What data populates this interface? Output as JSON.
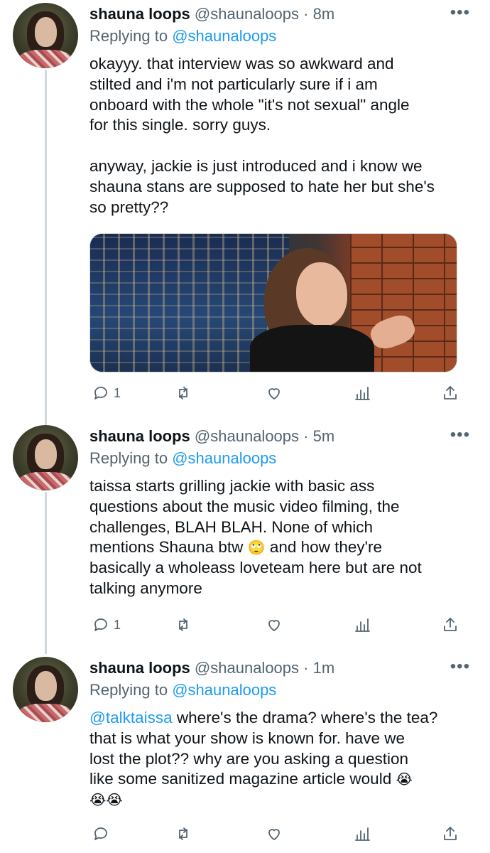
{
  "tweets": [
    {
      "name": "shauna loops",
      "handle": "@shaunaloops",
      "separator": "·",
      "time": "8m",
      "reply_prefix": "Replying to",
      "reply_to": "@shaunaloops",
      "body_lines": [
        "okayyy. that interview was so awkward and",
        "stilted and i'm not particularly sure if i am",
        "onboard with the whole \"it's not sexual\" angle",
        "for this single. sorry guys.",
        "",
        "anyway, jackie is just introduced and i know we",
        "shauna stans are supposed to hate her but she's",
        "so pretty??"
      ],
      "reply_count": "1",
      "retweet_count": "",
      "like_count": ""
    },
    {
      "name": "shauna loops",
      "handle": "@shaunaloops",
      "separator": "·",
      "time": "5m",
      "reply_prefix": "Replying to",
      "reply_to": "@shaunaloops",
      "body_lines": [
        "taissa starts grilling jackie with basic ass",
        "questions about the music video filming, the",
        "challenges, BLAH BLAH. None of which",
        "mentions Shauna btw",
        "basically a wholeass loveteam here but are not",
        "talking anymore"
      ],
      "emoji_eyeroll": "🙄",
      "line4_tail": " and how they're",
      "reply_count": "1",
      "retweet_count": "",
      "like_count": ""
    },
    {
      "name": "shauna loops",
      "handle": "@shaunaloops",
      "separator": "·",
      "time": "1m",
      "reply_prefix": "Replying to",
      "reply_to": "@shaunaloops",
      "mention": "@talktaissa",
      "line1_tail": " where's the drama? where's the tea?",
      "body_lines": [
        "that is what your show is known for. have we",
        "lost the plot?? why are you asking a question",
        "like some sanitized magazine article would"
      ],
      "emoji_sob": "😭",
      "emoji_sob_double": "😭😭",
      "reply_count": "",
      "retweet_count": "",
      "like_count": ""
    }
  ],
  "more_label": "•••",
  "icons": [
    "reply-icon",
    "retweet-icon",
    "like-icon",
    "analytics-icon",
    "share-icon"
  ],
  "colors": {
    "link": "#1d9bf0",
    "secondary": "#536471",
    "text": "#0f1419",
    "thread_line": "#cfd9de"
  }
}
